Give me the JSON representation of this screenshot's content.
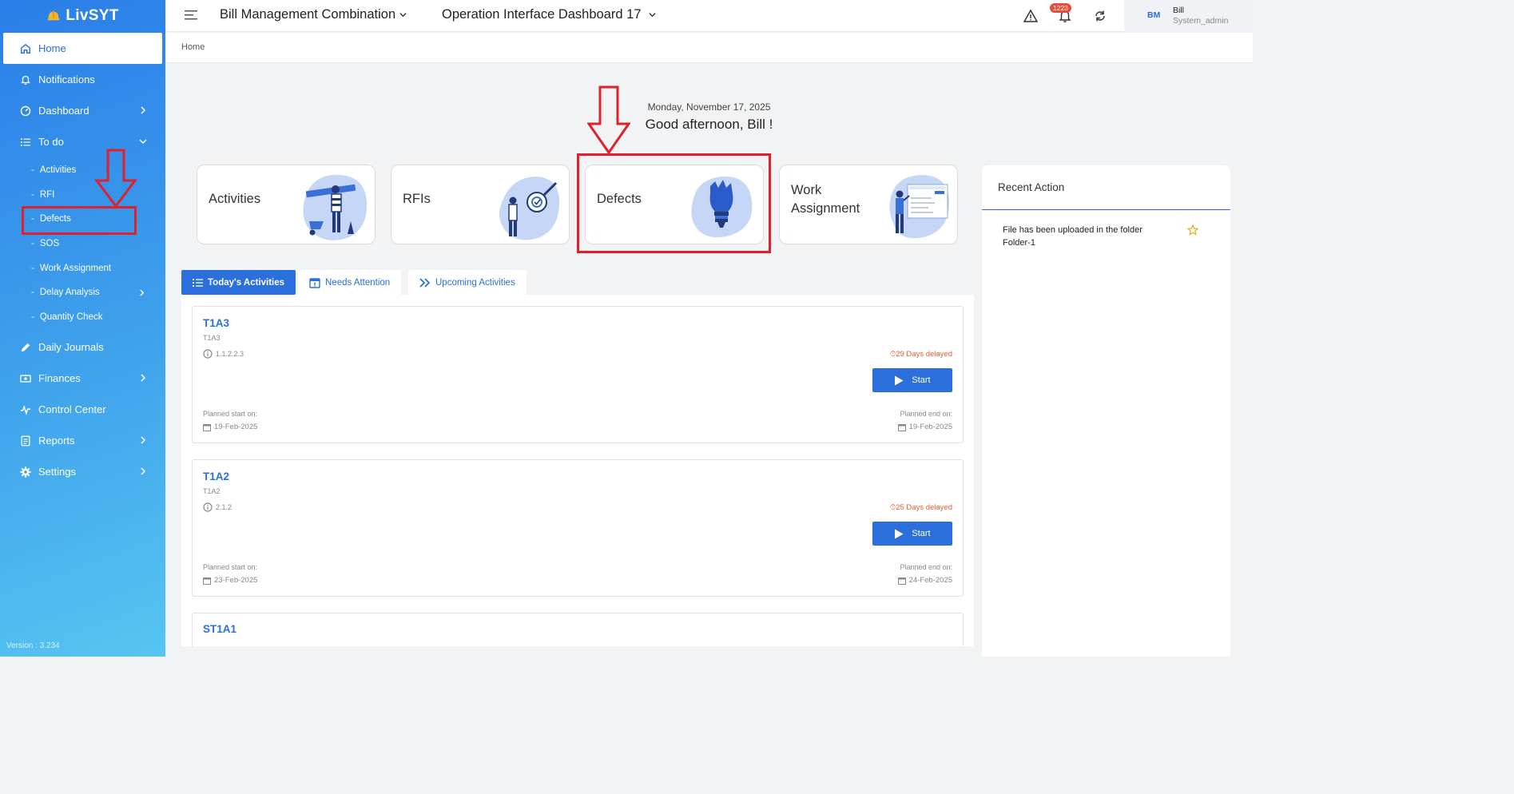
{
  "app": {
    "name": "LivSYT",
    "version": "Version : 3.234"
  },
  "sidebar": {
    "items": [
      {
        "label": "Home"
      },
      {
        "label": "Notifications"
      },
      {
        "label": "Dashboard"
      },
      {
        "label": "To do"
      },
      {
        "label": "Daily Journals"
      },
      {
        "label": "Finances"
      },
      {
        "label": "Control Center"
      },
      {
        "label": "Reports"
      },
      {
        "label": "Settings"
      }
    ],
    "todo_sub": [
      {
        "label": "Activities"
      },
      {
        "label": "RFI"
      },
      {
        "label": "Defects"
      },
      {
        "label": "SOS"
      },
      {
        "label": "Work Assignment"
      },
      {
        "label": "Delay Analysis"
      },
      {
        "label": "Quantity Check"
      }
    ]
  },
  "topbar": {
    "project": "Bill Management Combination",
    "dashboard": "Operation Interface Dashboard 17",
    "notification_count": "1223",
    "user_initials": "BM",
    "user_name": "Bill",
    "user_role": "System_admin"
  },
  "breadcrumb": "Home",
  "greeting": {
    "date": "Monday, November 17, 2025",
    "text": "Good afternoon, Bill !"
  },
  "cards": {
    "activities": {
      "line1": "Activities",
      "line2": ""
    },
    "rfis": {
      "line1": "RFIs",
      "line2": ""
    },
    "defects": {
      "line1": "Defects",
      "line2": ""
    },
    "work": {
      "line1": "Work",
      "line2": "Assignment"
    }
  },
  "tabs": {
    "today": "Today's Activities",
    "attention": "Needs Attention",
    "upcoming": "Upcoming Activities"
  },
  "activities": [
    {
      "title": "T1A3",
      "sub": "T1A3",
      "code": "1.1.2.2.3",
      "delay": "29 Days delayed",
      "start_label": "Start",
      "start_caption": "Planned start on:",
      "start_date": "19-Feb-2025",
      "end_caption": "Planned end on:",
      "end_date": "19-Feb-2025"
    },
    {
      "title": "T1A2",
      "sub": "T1A2",
      "code": "2.1.2",
      "delay": "25 Days delayed",
      "start_label": "Start",
      "start_caption": "Planned start on:",
      "start_date": "23-Feb-2025",
      "end_caption": "Planned end on:",
      "end_date": "24-Feb-2025"
    },
    {
      "title": "ST1A1"
    }
  ],
  "recent": {
    "title": "Recent Action",
    "items": [
      {
        "text": "File has been uploaded in the folder Folder-1"
      }
    ]
  },
  "colors": {
    "primary": "#2a6fdb",
    "annotation": "#e0202a",
    "delay": "#e85a2c"
  }
}
